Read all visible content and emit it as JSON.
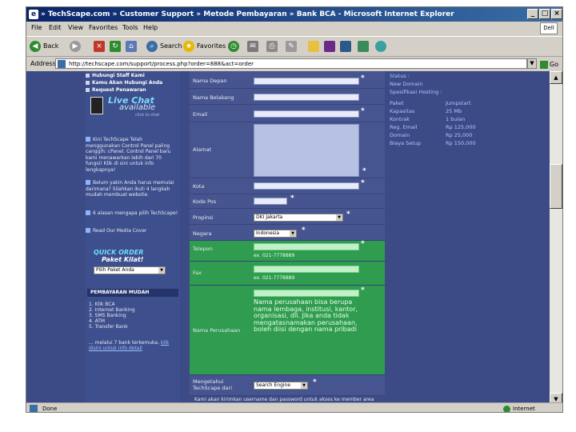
{
  "window": {
    "title": "» TechScape.com » Customer Support » Metode Pembayaran » Bank BCA - Microsoft Internet Explorer",
    "controls": {
      "minimize": "_",
      "maximize": "□",
      "close": "×"
    }
  },
  "menu": {
    "items": [
      "File",
      "Edit",
      "View",
      "Favorites",
      "Tools",
      "Help"
    ],
    "brand": "Dell"
  },
  "toolbar": {
    "back": "Back",
    "search": "Search",
    "favorites": "Favorites"
  },
  "address": {
    "label": "Address",
    "url": "http://techscape.com/support/process.php?order=888&act=order",
    "go": "Go"
  },
  "sidebar": {
    "top_links": [
      "Hubungi Staff Kami",
      "Kamu Akan Hubungi Anda",
      "Request Penawaran"
    ],
    "livechat": {
      "title": "Live Chat",
      "status": "available",
      "small": "click to chat"
    },
    "tips": [
      "Kini TechScape Telah menggunakan Control Panel paling canggih: cPanel. Control Panel baru kami menawarkan lebih dari 70 fungsi! Klik di sini untuk info lengkapnya!",
      "Belum yakin Anda harus memulai darimana? Silahkan ikuti 4 langkah mudah membuat website.",
      "6 alasan mengapa pilih TechScape!",
      "Read Our Media Cover"
    ],
    "quick_order": {
      "line1": "QUICK ORDER",
      "line2": "Paket Kilat!",
      "select": "Pilih Paket Anda"
    },
    "payment": {
      "header": "PEMBAYARAN MUDAH",
      "items": [
        "1. Klik BCA",
        "2. Internet Banking",
        "3. SMS Banking",
        "4. ATM",
        "5. Transfer Bank"
      ],
      "footer": "... melalui 7 bank terkemuka,",
      "footer_link": "klik disini untuk info detail"
    }
  },
  "form": {
    "nama_depan": "Nama Depan",
    "nama_belakang": "Nama Belakang",
    "email": "Email",
    "alamat": "Alamat",
    "kota": "Kota",
    "kode_pos": "Kode Pos",
    "propinsi": "Propinsi",
    "propinsi_value": "DKI Jakarta",
    "negara": "Negara",
    "negara_value": "Indonesia",
    "telepon": "Telepon",
    "telepon_hint": "ex. 021-7778889",
    "fax": "Fax",
    "fax_hint": "ex. 021-7778889",
    "nama_perusahaan": "Nama Perusahaan",
    "perusahaan_note": "Nama perusahaan bisa berupa nama lembaga, institusi, kantor, organisasi, dll. Jika anda tidak mengatasnamakan perusahaan, boleh diisi dengan nama pribadi",
    "mengetahui": "Mengetahui TechScape dari",
    "mengetahui_value": "Search Engine",
    "required_mark": "*",
    "bottom_text": "Kami akan kirimkan username dan password untuk akses ke member area"
  },
  "summary": {
    "status_label": "Status :",
    "status_value": "New Domain",
    "spec_label": "Spesifikasi Hosting :",
    "rows": [
      {
        "label": "Paket",
        "value": "Jumpstart"
      },
      {
        "label": "Kapasitas",
        "value": "25 Mb"
      },
      {
        "label": "Kontrak",
        "value": "1 bulan"
      },
      {
        "label": "Reg. Email",
        "value": "Rp 125,000"
      },
      {
        "label": "Domain",
        "value": "Rp 25,000"
      },
      {
        "label": "Biaya Setup",
        "value": "Rp 150,000"
      }
    ]
  },
  "statusbar": {
    "done": "Done",
    "zone": "Internet"
  }
}
